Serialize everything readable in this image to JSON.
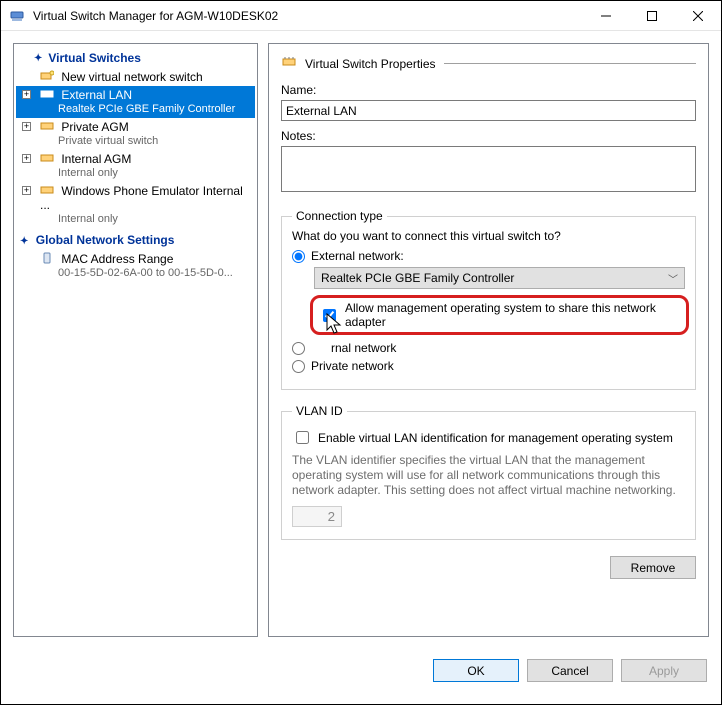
{
  "window": {
    "title": "Virtual Switch Manager for AGM-W10DESK02"
  },
  "tree": {
    "header1": "Virtual Switches",
    "new_switch": "New virtual network switch",
    "items": [
      {
        "label": "External LAN",
        "sub": "Realtek PCIe GBE Family Controller",
        "selected": true
      },
      {
        "label": "Private AGM",
        "sub": "Private virtual switch",
        "selected": false
      },
      {
        "label": "Internal AGM",
        "sub": "Internal only",
        "selected": false
      },
      {
        "label": "Windows Phone Emulator Internal ...",
        "sub": "Internal only",
        "selected": false
      }
    ],
    "header2": "Global Network Settings",
    "mac": {
      "label": "MAC Address Range",
      "sub": "00-15-5D-02-6A-00 to 00-15-5D-0..."
    }
  },
  "props": {
    "section_title": "Virtual Switch Properties",
    "name_label": "Name:",
    "name_value": "External LAN",
    "notes_label": "Notes:",
    "notes_value": ""
  },
  "conn": {
    "legend": "Connection type",
    "question": "What do you want to connect this virtual switch to?",
    "external_label": "External network:",
    "adapter": "Realtek PCIe GBE Family Controller",
    "allow_label": "Allow management operating system to share this network adapter",
    "internal_label": "rnal network",
    "private_label": "Private network"
  },
  "vlan": {
    "legend": "VLAN ID",
    "enable_label": "Enable virtual LAN identification for management operating system",
    "desc": "The VLAN identifier specifies the virtual LAN that the management operating system will use for all network communications through this network adapter. This setting does not affect virtual machine networking.",
    "value": "2"
  },
  "buttons": {
    "remove": "Remove",
    "ok": "OK",
    "cancel": "Cancel",
    "apply": "Apply"
  }
}
